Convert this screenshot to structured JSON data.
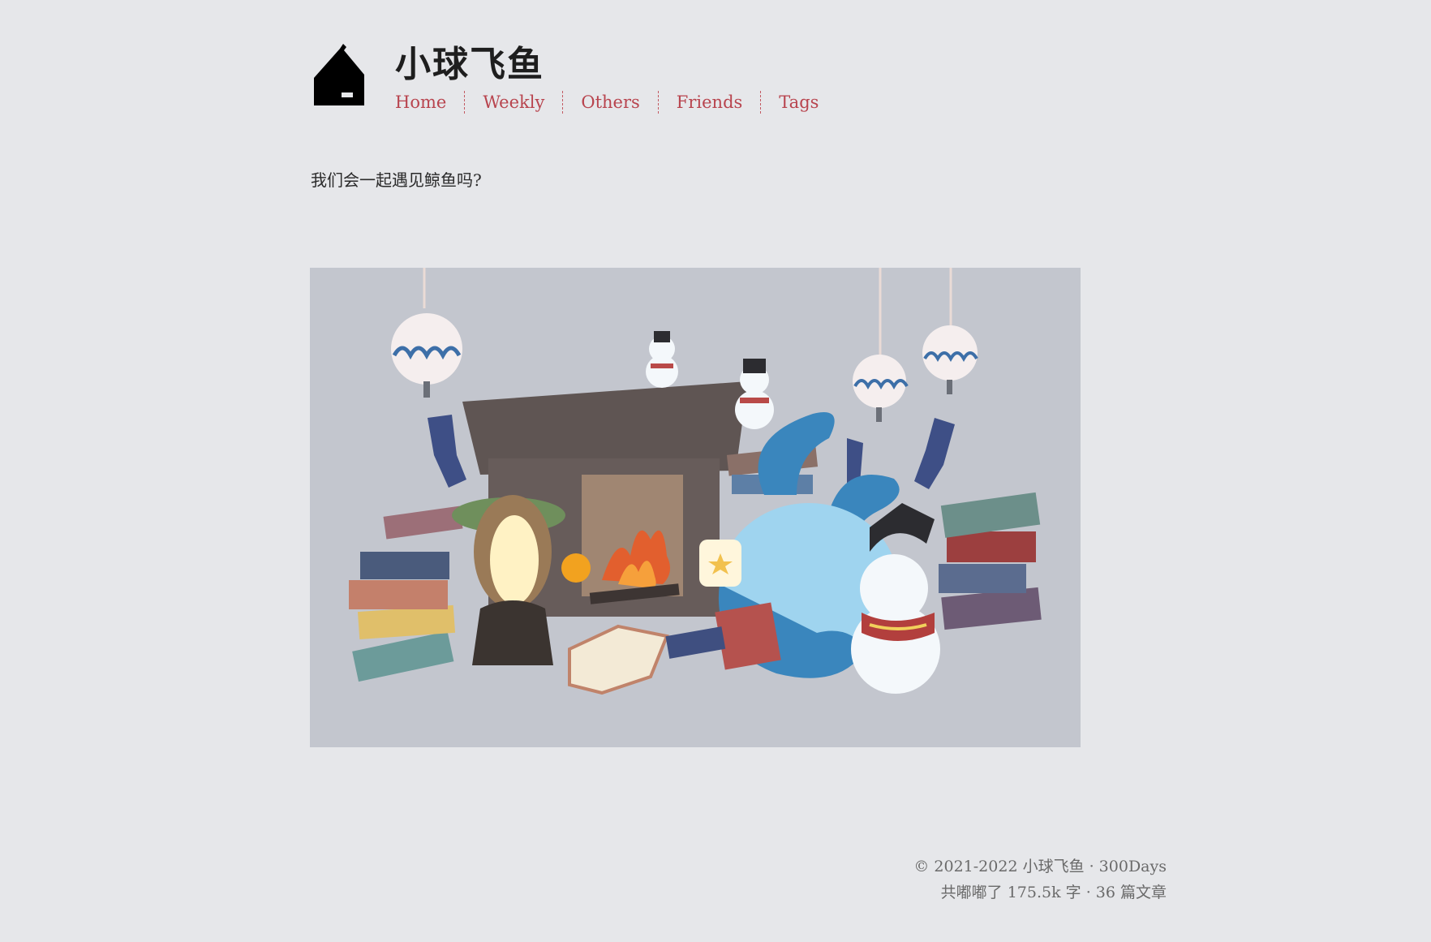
{
  "header": {
    "site_title": "小球飞鱼",
    "logo_icon": "house-tent-icon",
    "nav": [
      {
        "label": "Home"
      },
      {
        "label": "Weekly"
      },
      {
        "label": "Others"
      },
      {
        "label": "Friends"
      },
      {
        "label": "Tags"
      }
    ]
  },
  "main": {
    "tagline": "我们会一起遇见鲸鱼吗?",
    "illustration": {
      "subject": "cozy-fireplace-reading-scene"
    }
  },
  "footer": {
    "copyright": "© 2021-2022 小球飞鱼 · 300Days",
    "stats": "共嘟嘟了 175.5k 字 · 36 篇文章"
  },
  "colors": {
    "background": "#e6e7ea",
    "nav_link": "#b8444e",
    "illustration_bg": "#c3c6ce"
  }
}
